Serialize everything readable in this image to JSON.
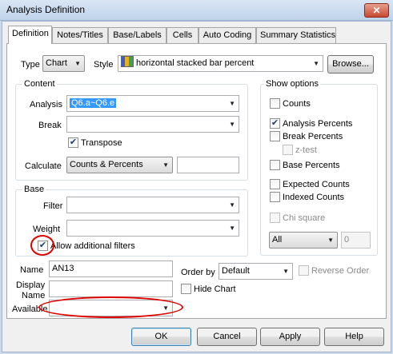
{
  "window": {
    "title": "Analysis Definition",
    "close_glyph": "✕"
  },
  "tabs": [
    "Definition",
    "Notes/Titles",
    "Base/Labels",
    "Cells",
    "Auto Coding",
    "Summary Statistics"
  ],
  "top": {
    "type_label": "Type",
    "type_value": "Chart",
    "style_label": "Style",
    "style_value": "horizontal stacked bar percent",
    "browse_label": "Browse..."
  },
  "content": {
    "group_label": "Content",
    "analysis_label": "Analysis",
    "analysis_value": "Q6.a~Q6.e",
    "break_label": "Break",
    "break_value": "",
    "transpose_label": "Transpose",
    "calculate_label": "Calculate",
    "calculate_value": "Counts & Percents",
    "calculate_extra": ""
  },
  "base": {
    "group_label": "Base",
    "filter_label": "Filter",
    "filter_value": "",
    "weight_label": "Weight",
    "weight_value": "",
    "allow_filters_label": "Allow additional filters"
  },
  "show_options": {
    "group_label": "Show options",
    "counts": "Counts",
    "analysis_percents": "Analysis Percents",
    "break_percents": "Break Percents",
    "z_test": "z-test",
    "base_percents": "Base Percents",
    "expected_counts": "Expected Counts",
    "indexed_counts": "Indexed Counts",
    "chi_square": "Chi square",
    "all_value": "All",
    "number_value": "0"
  },
  "bottom": {
    "name_label": "Name",
    "name_value": "AN13",
    "display_label_1": "Display",
    "display_label_2": "Name",
    "display_value": "",
    "available_label": "Available",
    "available_value": "",
    "order_by_label": "Order by",
    "order_by_value": "Default",
    "reverse_order_label": "Reverse Order",
    "hide_chart_label": "Hide Chart"
  },
  "buttons": {
    "ok": "OK",
    "cancel": "Cancel",
    "apply": "Apply",
    "help": "Help"
  },
  "checks": {
    "transpose": true,
    "allow_filters": true,
    "counts": false,
    "analysis_percents": true,
    "break_percents": false,
    "z_test": false,
    "base_percents": false,
    "expected_counts": false,
    "indexed_counts": false,
    "chi_square": false,
    "reverse_order": false,
    "hide_chart": false
  },
  "colors": {
    "annotation": "#e00000",
    "selection": "#3399ff"
  }
}
